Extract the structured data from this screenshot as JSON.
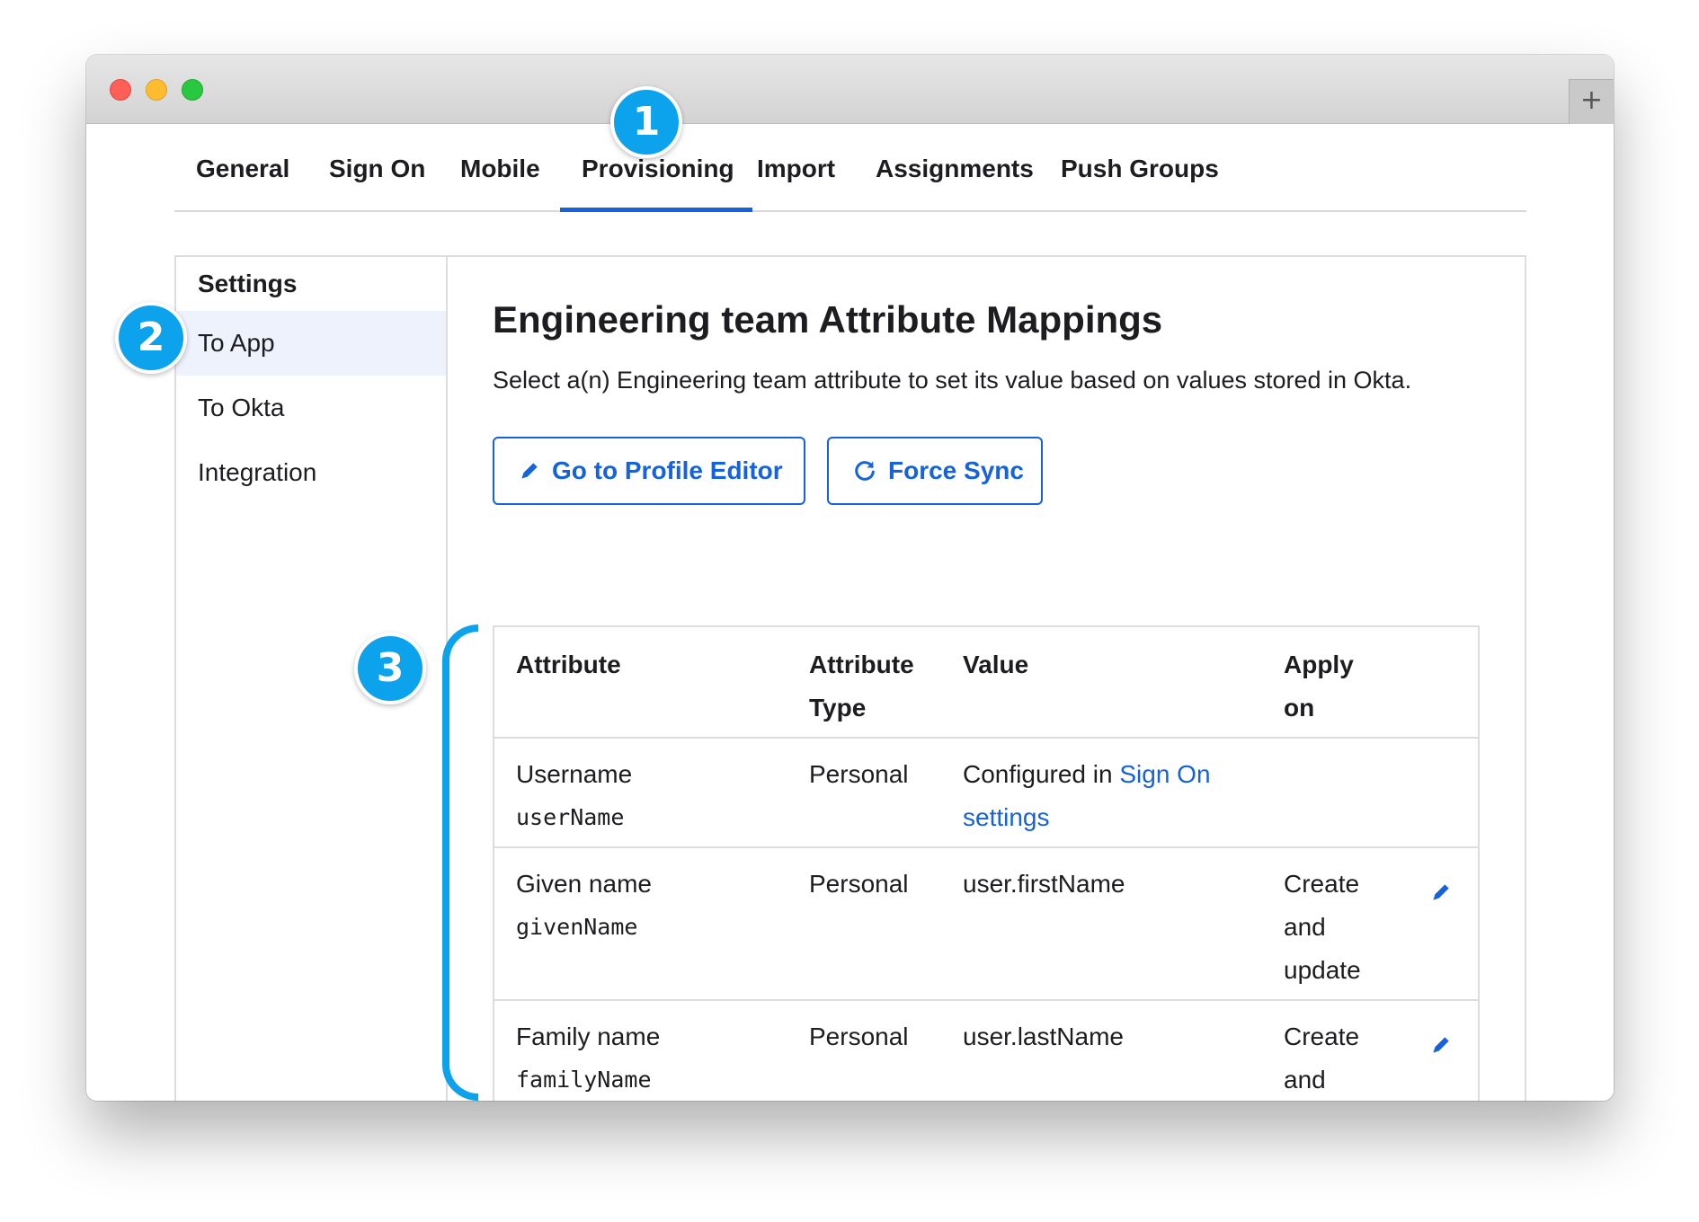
{
  "tabs": [
    {
      "label": "General"
    },
    {
      "label": "Sign On"
    },
    {
      "label": "Mobile"
    },
    {
      "label": "Provisioning"
    },
    {
      "label": "Import"
    },
    {
      "label": "Assignments"
    },
    {
      "label": "Push Groups"
    }
  ],
  "active_tab": "Provisioning",
  "sidebar": {
    "heading": "Settings",
    "items": [
      {
        "label": "To App"
      },
      {
        "label": "To Okta"
      },
      {
        "label": "Integration"
      }
    ],
    "active_item": "To App"
  },
  "main": {
    "title": "Engineering team Attribute Mappings",
    "description": "Select a(n) Engineering team attribute to set its value based on values stored in Okta.",
    "buttons": {
      "profile_editor": "Go to Profile Editor",
      "force_sync": "Force Sync"
    }
  },
  "table": {
    "headers": {
      "attribute": "Attribute",
      "attribute_type_1": "Attribute",
      "attribute_type_2": "Type",
      "value": "Value",
      "apply_on_1": "Apply",
      "apply_on_2": "on"
    },
    "rows": [
      {
        "name": "Username",
        "variable": "userName",
        "type": "Personal",
        "value_prefix": "Configured in ",
        "value_link_1": "Sign On",
        "value_link_2": "settings"
      },
      {
        "name": "Given name",
        "variable": "givenName",
        "type": "Personal",
        "value": "user.firstName",
        "apply_1": "Create",
        "apply_2": "and",
        "apply_3": "update"
      },
      {
        "name": "Family name",
        "variable": "familyName",
        "type": "Personal",
        "value": "user.lastName",
        "apply_1": "Create",
        "apply_2": "and"
      }
    ]
  },
  "callouts": [
    "1",
    "2",
    "3"
  ],
  "window": {
    "new_tab_symbol": "+"
  },
  "colors": {
    "accent": "#1662dd",
    "callout": "#0ca3ec",
    "active_sidebar_bg": "#eef2fd",
    "border": "#dcdce0"
  },
  "icons": {
    "edit": "pencil-icon",
    "sync": "refresh-icon"
  }
}
